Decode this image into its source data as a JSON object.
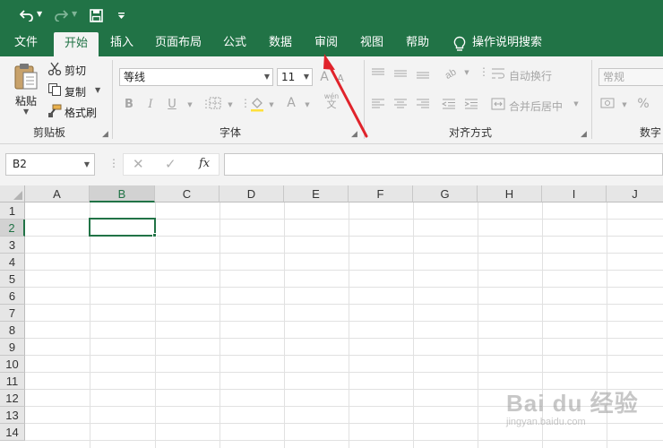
{
  "quick_access": {
    "undo_icon": "undo-icon",
    "redo_icon": "redo-icon",
    "save_icon": "save-icon",
    "customize_icon": "customize-qat-icon"
  },
  "tabs": [
    "文件",
    "开始",
    "插入",
    "页面布局",
    "公式",
    "数据",
    "审阅",
    "视图",
    "帮助",
    "操作说明搜索"
  ],
  "active_tab": "开始",
  "ribbon": {
    "clipboard": {
      "paste": "粘贴",
      "cut": "剪切",
      "copy": "复制",
      "format_painter": "格式刷",
      "label": "剪贴板"
    },
    "font": {
      "font_name": "等线",
      "font_size": "11",
      "grow_font": "A",
      "shrink_font": "A",
      "bold": "B",
      "italic": "I",
      "underline": "U",
      "font_color": "A",
      "phonetic_top": "wén",
      "phonetic_bottom": "文",
      "label": "字体"
    },
    "alignment": {
      "wrap_text": "自动换行",
      "merge_center": "合并后居中",
      "label": "对齐方式"
    },
    "number": {
      "format": "常规",
      "percent": "%",
      "label": "数字"
    }
  },
  "formula_bar": {
    "name_box": "B2",
    "cancel": "✕",
    "enter": "✓",
    "fx": "fx",
    "formula": ""
  },
  "grid": {
    "columns": [
      "A",
      "B",
      "C",
      "D",
      "E",
      "F",
      "G",
      "H",
      "I",
      "J"
    ],
    "rows": [
      "1",
      "2",
      "3",
      "4",
      "5",
      "6",
      "7",
      "8",
      "9",
      "10",
      "11",
      "12",
      "13",
      "14"
    ],
    "selected_cell": "B2",
    "selected_column": "B",
    "selected_row": "2"
  },
  "colors": {
    "excel_green": "#217346",
    "annotation_red": "#e0232b"
  },
  "watermark": {
    "main": "Bai du 经验",
    "sub": "jingyan.baidu.com"
  }
}
